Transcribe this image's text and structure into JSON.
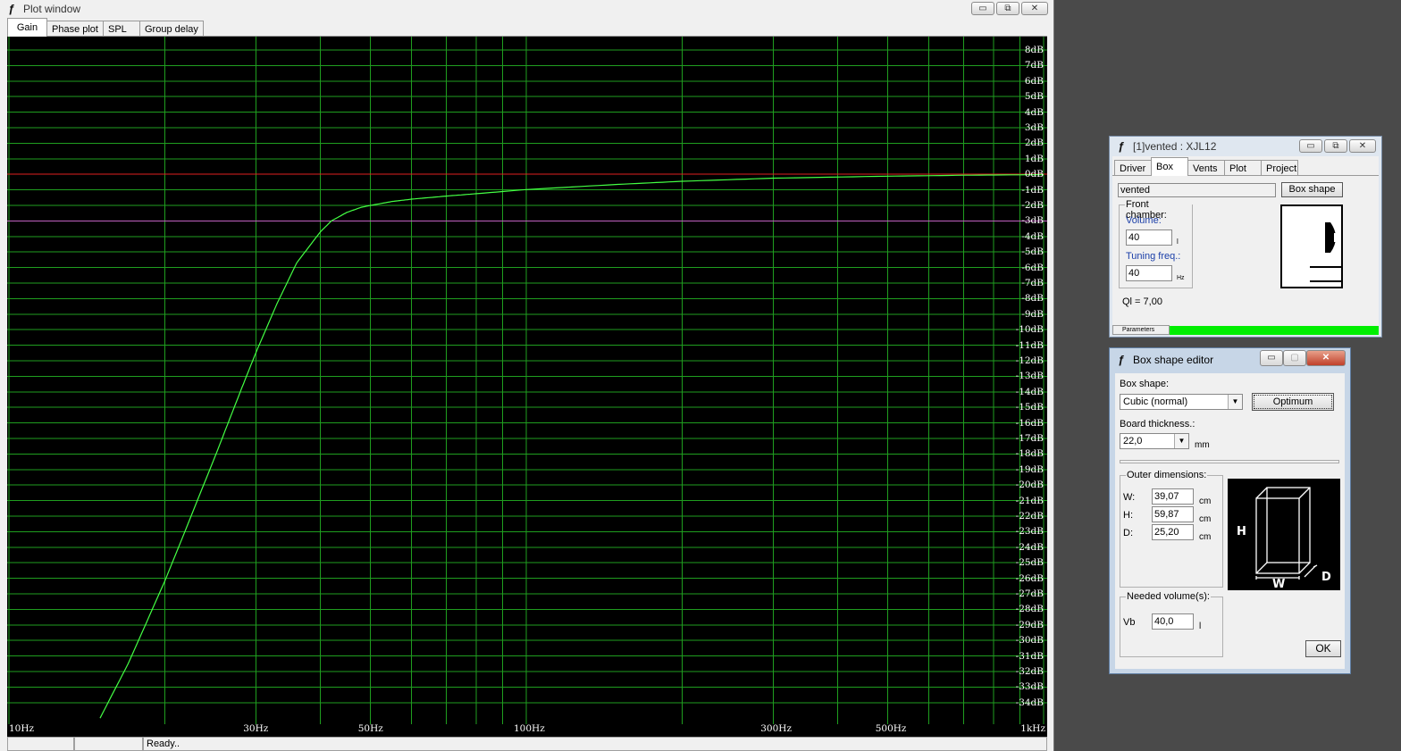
{
  "plot_window": {
    "title": "Plot window",
    "tabs": [
      "Gain",
      "Phase plot",
      "SPL",
      "Group delay"
    ],
    "active_tab": "Gain",
    "status": "Ready..",
    "window_buttons": {
      "minimize": "▭",
      "maximize": "⧉",
      "close": "✕"
    }
  },
  "chart_data": {
    "type": "line",
    "xscale": "log",
    "xlim": [
      10,
      1000
    ],
    "ylim": [
      -35,
      9
    ],
    "x_tick_labels": [
      {
        "value": 10,
        "label": "10Hz"
      },
      {
        "value": 30,
        "label": "30Hz"
      },
      {
        "value": 50,
        "label": "50Hz"
      },
      {
        "value": 100,
        "label": "100Hz"
      },
      {
        "value": 300,
        "label": "300Hz"
      },
      {
        "value": 500,
        "label": "500Hz"
      },
      {
        "value": 1000,
        "label": "1kHz"
      }
    ],
    "y_ticks": [
      8,
      7,
      6,
      5,
      4,
      3,
      2,
      1,
      0,
      -1,
      -2,
      -3,
      -4,
      -5,
      -6,
      -7,
      -8,
      -9,
      -10,
      -11,
      -12,
      -13,
      -14,
      -15,
      -16,
      -17,
      -18,
      -19,
      -20,
      -21,
      -22,
      -23,
      -24,
      -25,
      -26,
      -27,
      -28,
      -29,
      -30,
      -31,
      -32,
      -33,
      -34
    ],
    "y_unit": "dB",
    "grid": true,
    "grid_color": "#1f9e1f",
    "reference_line": {
      "y": 0,
      "color": "#e02020"
    },
    "secondary_line": {
      "y": -3,
      "color": "#c060c0"
    },
    "series": [
      {
        "color": "#44ff44",
        "x": [
          15,
          17,
          20,
          22,
          25,
          28,
          30,
          33,
          36,
          40,
          42,
          45,
          48,
          50,
          55,
          60,
          70,
          80,
          100,
          150,
          200,
          300,
          500,
          700,
          1000
        ],
        "y": [
          -35,
          -31.5,
          -26.2,
          -22.8,
          -18.2,
          -14.0,
          -11.5,
          -8.3,
          -5.7,
          -3.7,
          -3.0,
          -2.45,
          -2.12,
          -2.0,
          -1.75,
          -1.6,
          -1.4,
          -1.25,
          -0.98,
          -0.65,
          -0.45,
          -0.25,
          -0.12,
          -0.06,
          -0.02
        ]
      }
    ]
  },
  "driver_window": {
    "title": "[1]vented : XJL12",
    "tabs": [
      "Driver",
      "Box",
      "Vents",
      "Plot",
      "Project"
    ],
    "active_tab": "Box",
    "box_name": "vented",
    "box_shape_button": "Box shape",
    "front_chamber_label": "Front chamber:",
    "volume_label": "Volume:",
    "volume_value": "40",
    "volume_unit": "l",
    "tuning_label": "Tuning freq.:",
    "tuning_value": "40",
    "tuning_unit": "Hz",
    "ql_text": "Ql = 7,00",
    "parameters_tab": "Parameters",
    "accent_color": "#00ee00"
  },
  "box_editor": {
    "title": "Box shape editor",
    "box_shape_label": "Box shape:",
    "box_shape_value": "Cubic (normal)",
    "optimum_button": "Optimum",
    "board_label": "Board thickness.:",
    "board_value": "22,0",
    "board_unit": "mm",
    "outer_label": "Outer dimensions:",
    "dims": [
      {
        "label": "W:",
        "value": "39,07",
        "unit": "cm"
      },
      {
        "label": "H:",
        "value": "59,87",
        "unit": "cm"
      },
      {
        "label": "D:",
        "value": "25,20",
        "unit": "cm"
      }
    ],
    "diagram_labels": {
      "h": "H",
      "w": "W",
      "d": "D"
    },
    "needed_label": "Needed volume(s):",
    "vb_label": "Vb",
    "vb_value": "40,0",
    "vb_unit": "l",
    "ok_button": "OK"
  }
}
